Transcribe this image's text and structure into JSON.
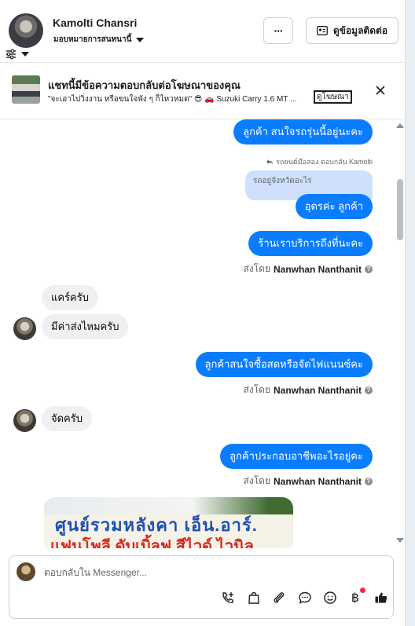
{
  "header": {
    "user_name": "Kamolti Chansri",
    "assign_label": "มอบหมายการสนทนานี้",
    "more_label": "···",
    "contact_label": "ดูข้อมูลติดต่อ"
  },
  "ad_banner": {
    "title": "แชทนี้มีข้อความตอบกลับต่อโฆษณาของคุณ",
    "subtitle": "\"จะเอาไปวิ่งงาน หรือขนใจพัง ๆ ก็ไหวหมด\" 😎 🚗 Suzuki Carry 1.6 MT ...",
    "link_label": "ดูโฆษณา"
  },
  "messages": {
    "m1": "ลูกค้า สนใจรถรุ่นนี้อยู่นะคะ",
    "reply_note": "รถยนต์มือสอง ตอบกลับ Kamolti",
    "quoted": "รถอยู่จังหวัดอะไร",
    "m2": "อุดรค่ะ  ลูกค้า",
    "m3": "ร้านเราบริการถึงที่นะคะ",
    "sent_by_prefix": "ส่งโดย",
    "sent_by_name": "Nanwhan Nanthanit",
    "in1": "แคร์ครับ",
    "in2": "มีค่าส่งไหมครับ",
    "m4": "ลูกค้าสนใจซื้อสดหรือจัดไฟแนนซ์คะ",
    "in3": "จัดครับ",
    "m5": "ลูกค้าประกอบอาชีพอะไรอยู่คะ",
    "photo_line1": "ศูนย์รวมหลังคา เอ็น.อาร์.",
    "photo_line2": "แฟนโพลี ดับเบิ้ลฟ สีไวด์ ไวนิล"
  },
  "composer": {
    "placeholder": "ตอบกลับใน Messenger..."
  },
  "colors": {
    "outgoing_bubble": "#0a7cff",
    "incoming_bubble": "#f0f0f0",
    "notification_dot": "#f02849"
  },
  "icons": [
    "filter-icon",
    "more-icon",
    "contact-card-icon",
    "close-icon",
    "reply-arrow-icon",
    "info-icon",
    "call-add-icon",
    "shopping-bag-icon",
    "attach-icon",
    "chat-bubble-icon",
    "emoji-icon",
    "baht-icon",
    "thumbs-up-icon"
  ]
}
